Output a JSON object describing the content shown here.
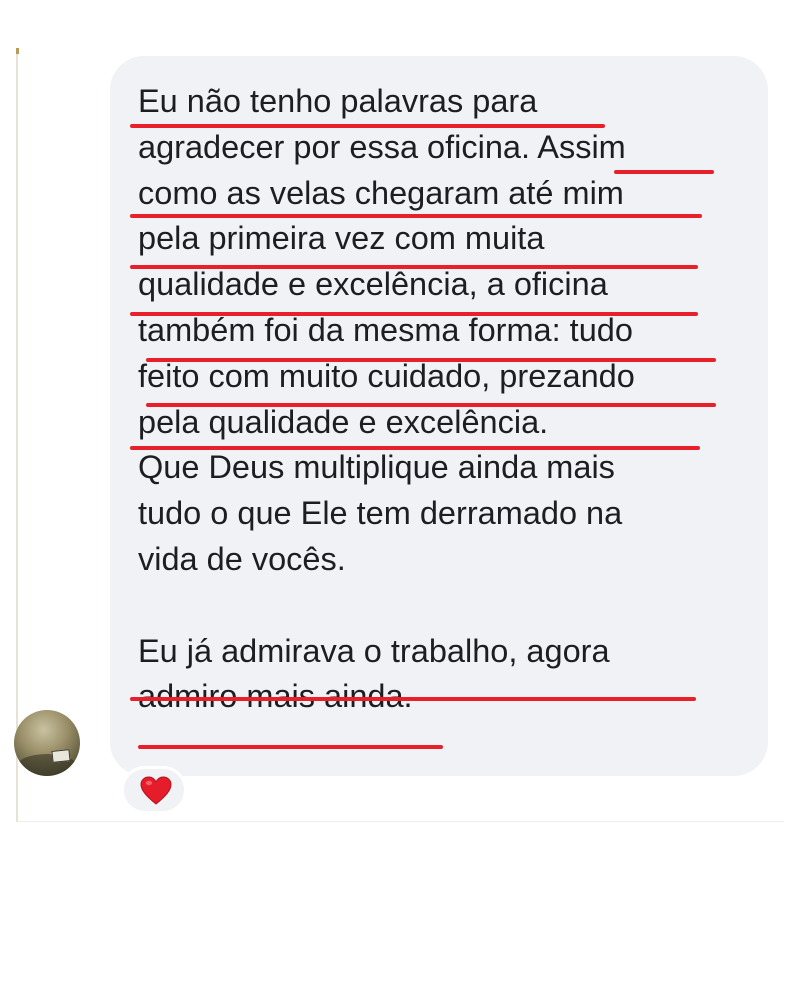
{
  "conversation": {
    "message": {
      "paragraph_1": [
        "Eu não tenho palavras para",
        "agradecer por essa oficina. Assim",
        "como as velas chegaram até mim",
        "pela primeira vez com muita",
        "qualidade e excelência, a oficina",
        "também foi da mesma forma: tudo",
        "feito com muito cuidado, prezando",
        "pela qualidade e excelência.",
        "Que Deus multiplique ainda mais",
        "tudo o que Ele tem derramado na",
        "vida de vocês."
      ],
      "paragraph_2": [
        "Eu já admirava o trabalho, agora",
        "admiro mais ainda."
      ],
      "colors": {
        "bubble_background": "#f1f2f5",
        "text": "#1c1e21",
        "highlight_underline": "#e8202a"
      }
    },
    "reaction": {
      "emoji": "❤️",
      "icon": "red-heart-icon"
    },
    "sender_avatar": {
      "icon": "avatar-photo"
    }
  }
}
